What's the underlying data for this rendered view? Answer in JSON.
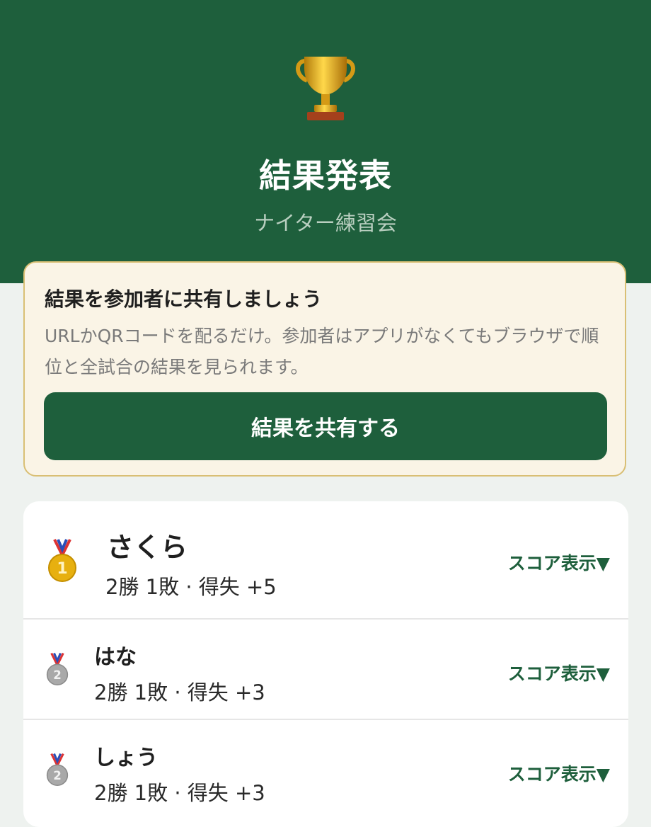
{
  "header": {
    "title": "結果発表",
    "subtitle": "ナイター練習会",
    "trophy_icon": "trophy-icon"
  },
  "share": {
    "title": "結果を参加者に共有しましょう",
    "description": "URLかQRコードを配るだけ。参加者はアプリがなくてもブラウザで順位と全試合の結果を見られます。",
    "button_label": "結果を共有する"
  },
  "results": [
    {
      "rank": 1,
      "medal_icon": "gold-medal-icon",
      "name": "さくら",
      "record": "2勝 1敗 · 得失 +5",
      "toggle_label": "スコア表示▼"
    },
    {
      "rank": 2,
      "medal_icon": "silver-medal-icon",
      "name": "はな",
      "record": "2勝 1敗 · 得失 +3",
      "toggle_label": "スコア表示▼"
    },
    {
      "rank": 2,
      "medal_icon": "silver-medal-icon",
      "name": "しょう",
      "record": "2勝 1敗 · 得失 +3",
      "toggle_label": "スコア表示▼"
    }
  ],
  "colors": {
    "primary": "#1e5f3c",
    "card_bg": "#faf4e6",
    "card_border": "#d9bf74",
    "gold": "#e7b00f",
    "silver": "#a9a9a9"
  }
}
